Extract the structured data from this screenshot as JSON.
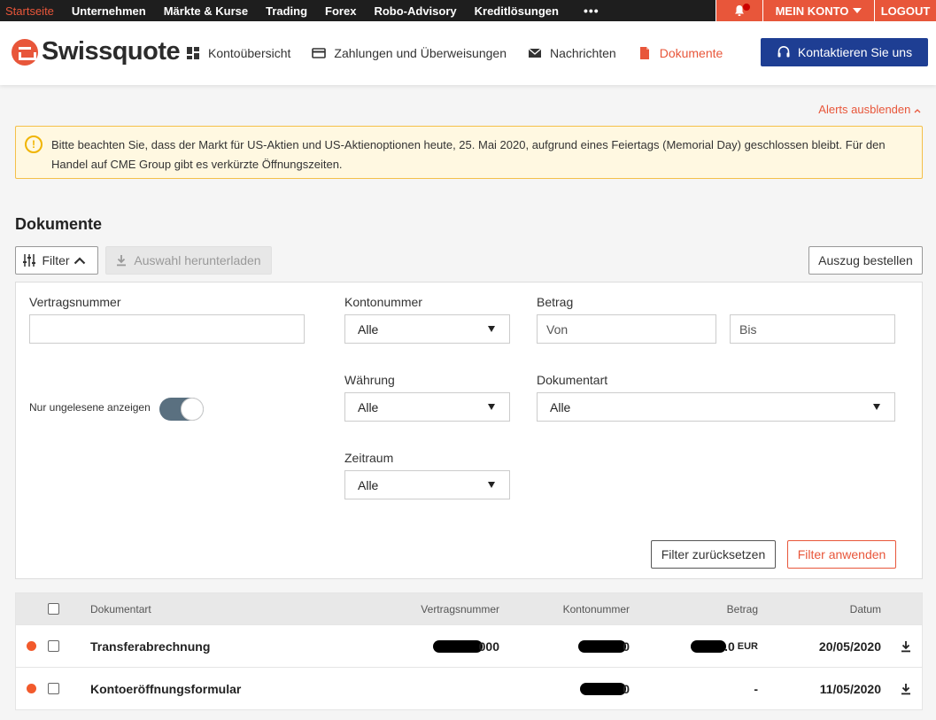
{
  "topnav": {
    "items": [
      "Startseite",
      "Unternehmen",
      "Märkte & Kurse",
      "Trading",
      "Forex",
      "Robo-Advisory",
      "Kreditlösungen"
    ],
    "more": "•••",
    "mein_konto": "MEIN KONTO",
    "logout": "LOGOUT"
  },
  "header": {
    "logo": "Swissquote",
    "nav": [
      {
        "label": "Kontoübersicht",
        "icon": "dashboard-icon"
      },
      {
        "label": "Zahlungen und Überweisungen",
        "icon": "credit-card-icon"
      },
      {
        "label": "Nachrichten",
        "icon": "envelope-icon"
      },
      {
        "label": "Dokumente",
        "icon": "document-icon"
      }
    ],
    "contact": "Kontaktieren Sie uns"
  },
  "alerts": {
    "toggle": "Alerts ausblenden",
    "message": "Bitte beachten Sie, dass der Markt für US-Aktien und US-Aktienoptionen heute, 25. Mai 2020, aufgrund eines Feiertags (Memorial Day) geschlossen bleibt. Für den Handel auf CME Group gibt es verkürzte Öffnungszeiten."
  },
  "page_title": "Dokumente",
  "toolbar": {
    "filter": "Filter",
    "download": "Auswahl herunterladen",
    "order": "Auszug bestellen"
  },
  "filters": {
    "vertragsnummer_label": "Vertragsnummer",
    "vertragsnummer_value": "",
    "kontonummer_label": "Kontonummer",
    "kontonummer_value": "Alle",
    "betrag_label": "Betrag",
    "betrag_von_placeholder": "Von",
    "betrag_bis_placeholder": "Bis",
    "waehrung_label": "Währung",
    "waehrung_value": "Alle",
    "dokumentart_label": "Dokumentart",
    "dokumentart_value": "Alle",
    "zeitraum_label": "Zeitraum",
    "zeitraum_value": "Alle",
    "unread_label": "Nur ungelesene anzeigen",
    "reset": "Filter zurücksetzen",
    "apply": "Filter anwenden"
  },
  "table": {
    "headers": {
      "dokumentart": "Dokumentart",
      "vertragsnummer": "Vertragsnummer",
      "kontonummer": "Kontonummer",
      "betrag": "Betrag",
      "datum": "Datum"
    },
    "rows": [
      {
        "dokumentart": "Transferabrechnung",
        "vertragsnummer_tail": "000",
        "kontonummer_tail": "0",
        "betrag_tail": ".0",
        "currency": "EUR",
        "datum": "20/05/2020"
      },
      {
        "dokumentart": "Kontoeröffnungsformular",
        "kontonummer_tail": "0",
        "betrag": "-",
        "datum": "11/05/2020"
      }
    ]
  },
  "colors": {
    "accent": "#e8563a",
    "topbar": "#1e1e1e",
    "contact": "#1e3e93",
    "alert_bg": "#fff8e1",
    "alert_border": "#f4c04a"
  }
}
